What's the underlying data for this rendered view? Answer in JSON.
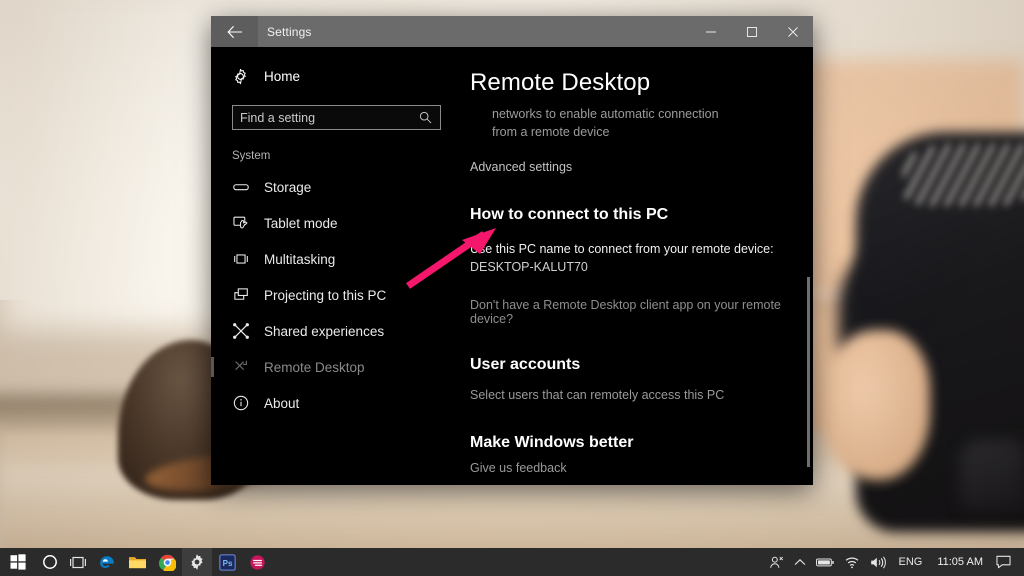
{
  "window": {
    "title": "Settings",
    "back_icon": "back-arrow-icon",
    "minimize_label": "–",
    "maximize_label": "□",
    "close_label": "✕"
  },
  "sidebar": {
    "home_label": "Home",
    "home_icon": "gear-icon",
    "search": {
      "placeholder": "Find a setting",
      "value": "",
      "icon": "search-icon"
    },
    "section_label": "System",
    "items": [
      {
        "label": "Storage",
        "icon": "storage-icon",
        "selected": false
      },
      {
        "label": "Tablet mode",
        "icon": "tablet-mode-icon",
        "selected": false
      },
      {
        "label": "Multitasking",
        "icon": "multitasking-icon",
        "selected": false
      },
      {
        "label": "Projecting to this PC",
        "icon": "projecting-icon",
        "selected": false
      },
      {
        "label": "Shared experiences",
        "icon": "shared-experiences-icon",
        "selected": false
      },
      {
        "label": "Remote Desktop",
        "icon": "remote-desktop-icon",
        "selected": true
      },
      {
        "label": "About",
        "icon": "info-icon",
        "selected": false
      }
    ]
  },
  "content": {
    "page_title": "Remote Desktop",
    "intro_line1": "networks to enable automatic connection",
    "intro_line2": "from a remote device",
    "advanced_settings": "Advanced settings",
    "how_to_connect": {
      "heading": "How to connect to this PC",
      "instruction": "Use this PC name to connect from your remote device:",
      "pc_name": "DESKTOP-KALUT70",
      "client_app_link": "Don't have a Remote Desktop client app on your remote device?"
    },
    "user_accounts": {
      "heading": "User accounts",
      "description": "Select users that can remotely access this PC"
    },
    "make_windows_better": {
      "heading": "Make Windows better",
      "feedback_link": "Give us feedback"
    }
  },
  "annotation": {
    "arrow_color": "#f5176b",
    "points_to": "DESKTOP-KALUT70"
  },
  "taskbar": {
    "start_icon": "windows-start-icon",
    "cortana_icon": "cortana-circle-icon",
    "task_view_icon": "task-view-icon",
    "apps": [
      {
        "name": "edge-icon",
        "active": false
      },
      {
        "name": "file-explorer-icon",
        "active": false
      },
      {
        "name": "chrome-icon",
        "active": false
      },
      {
        "name": "settings-icon",
        "active": true
      },
      {
        "name": "photoshop-icon",
        "active": false
      },
      {
        "name": "app-icon",
        "active": false
      }
    ],
    "tray": {
      "people_icon": "people-icon",
      "show_hidden_icon": "chevron-up-icon",
      "battery_icon": "battery-icon",
      "wifi_icon": "wifi-icon",
      "volume_icon": "volume-icon",
      "language": "ENG",
      "clock": "11:05 AM",
      "action_center_icon": "action-center-icon"
    }
  }
}
